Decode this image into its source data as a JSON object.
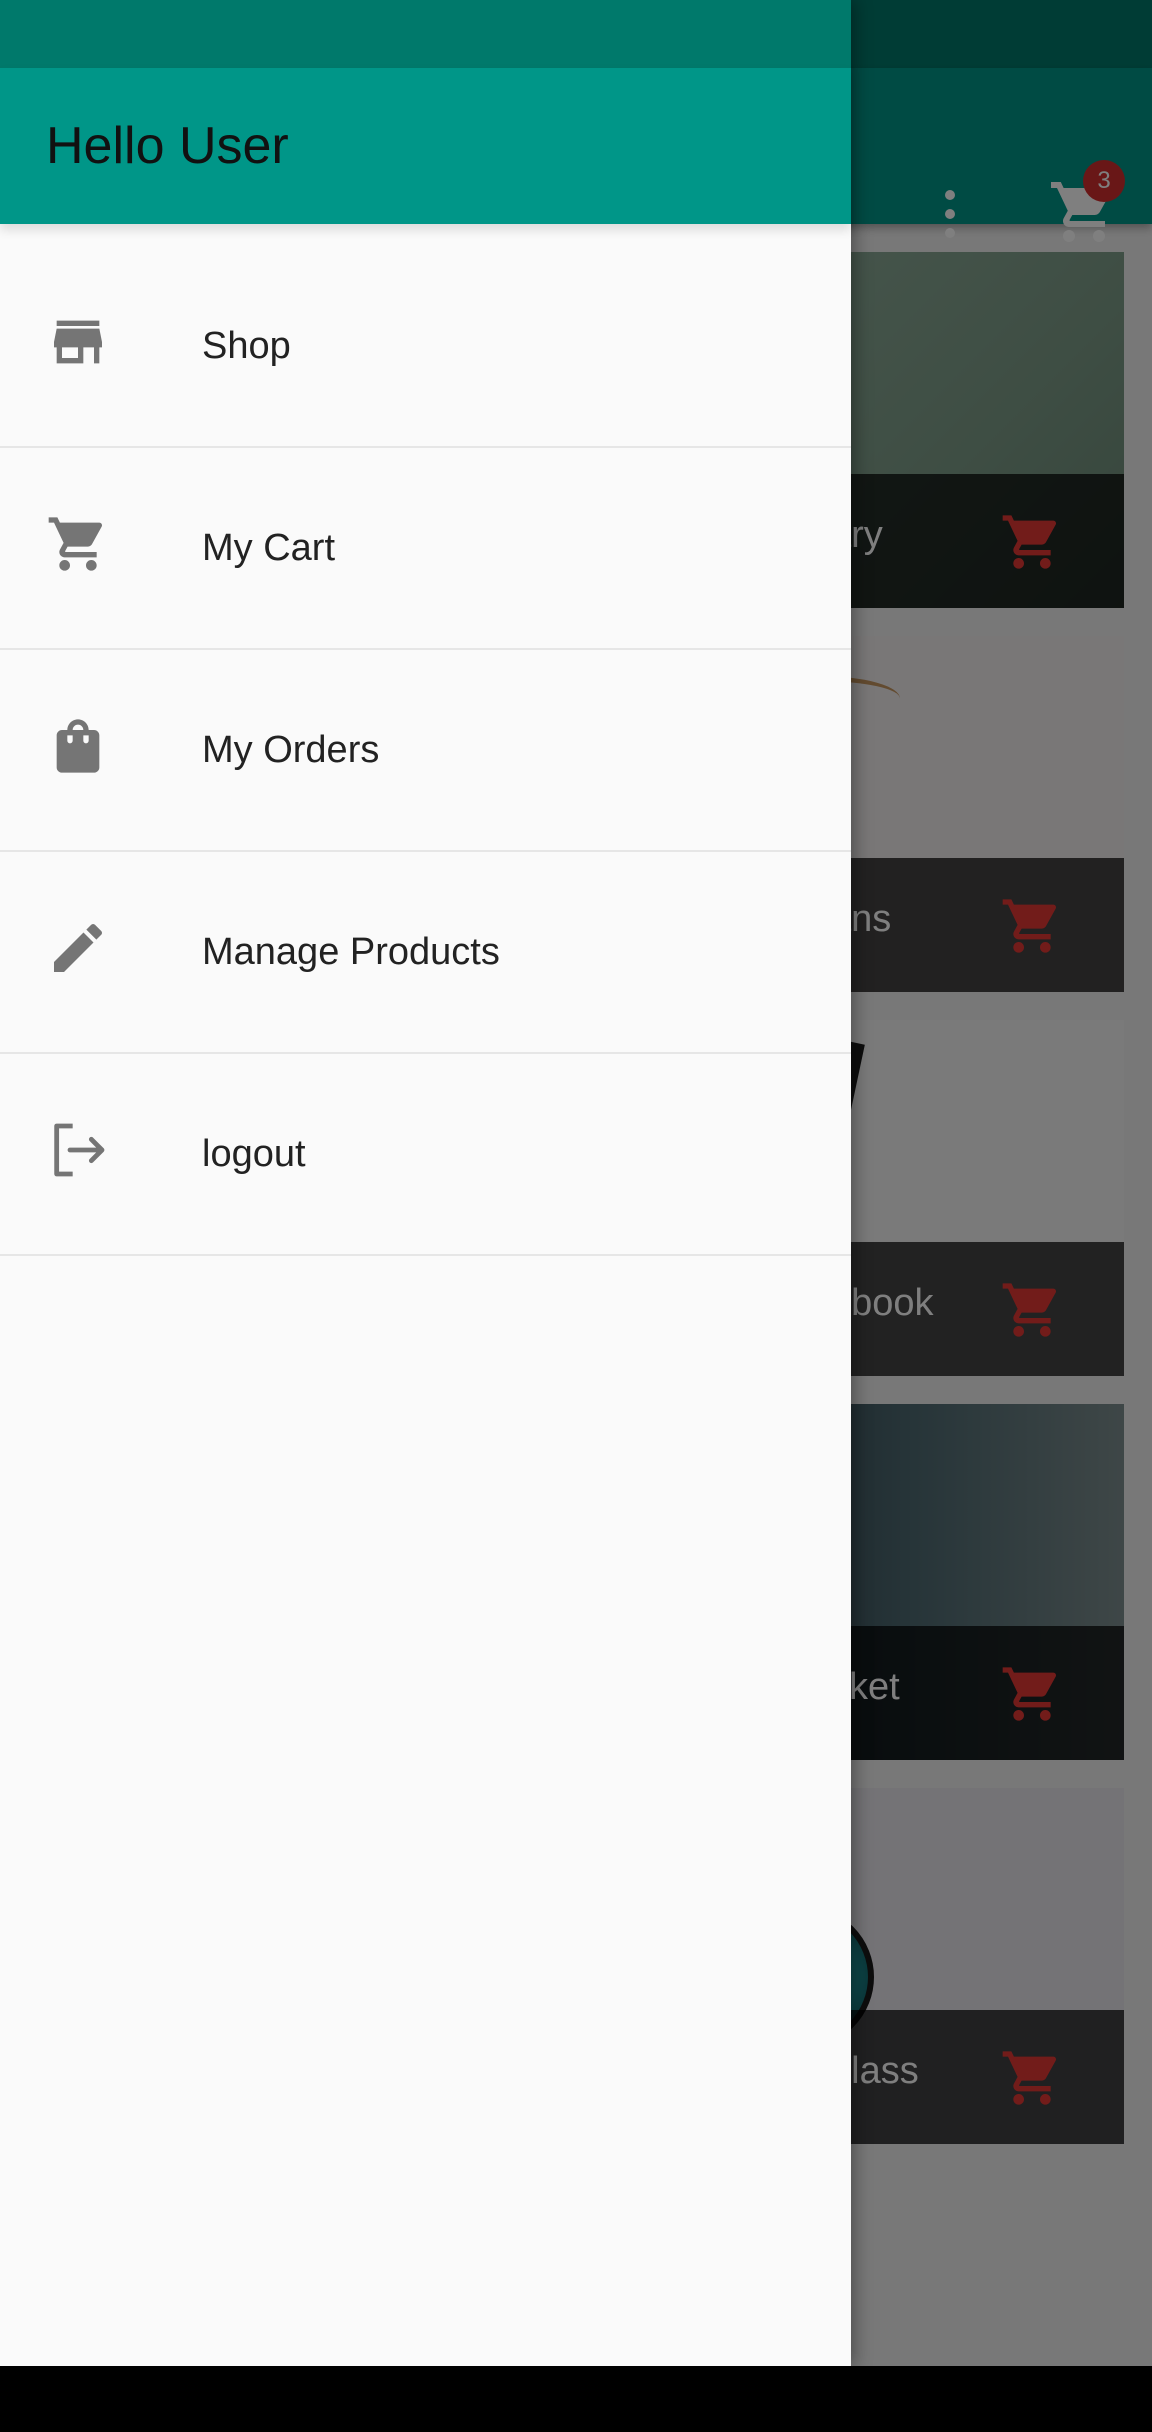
{
  "app": {
    "cart_count": "3",
    "accent_color": "#009688",
    "cart_icon_color": "#d32f2f"
  },
  "drawer": {
    "title": "Hello User",
    "items": [
      {
        "label": "Shop",
        "icon": "store-icon"
      },
      {
        "label": "My Cart",
        "icon": "cart-icon"
      },
      {
        "label": "My Orders",
        "icon": "shopping-bag-icon"
      },
      {
        "label": "Manage Products",
        "icon": "pencil-icon"
      },
      {
        "label": "logout",
        "icon": "logout-icon"
      }
    ]
  },
  "products": [
    {
      "title": "ary"
    },
    {
      "title": "ans"
    },
    {
      "title": "ebook"
    },
    {
      "title": "cket"
    },
    {
      "title": "glass"
    }
  ]
}
